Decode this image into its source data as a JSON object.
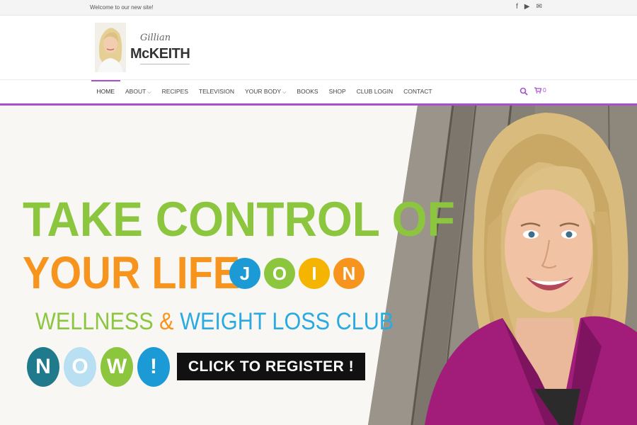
{
  "topbar": {
    "welcome": "Welcome to our new site!",
    "social": [
      {
        "icon": "facebook-icon",
        "glyph": "f"
      },
      {
        "icon": "youtube-icon",
        "glyph": "▶"
      },
      {
        "icon": "mail-icon",
        "glyph": "✉"
      }
    ]
  },
  "logo": {
    "script": "Gillian",
    "name": "McKEITH"
  },
  "nav": {
    "items": [
      {
        "label": "HOME",
        "active": true
      },
      {
        "label": "ABOUT",
        "caret": true
      },
      {
        "label": "RECIPES"
      },
      {
        "label": "TELEVISION"
      },
      {
        "label": "YOUR BODY",
        "caret": true
      },
      {
        "label": "BOOKS"
      },
      {
        "label": "SHOP"
      },
      {
        "label": "CLUB LOGIN"
      },
      {
        "label": "CONTACT"
      }
    ],
    "cart_count": "0",
    "accent": "#a84fd0"
  },
  "hero": {
    "line1": "TAKE CONTROL OF",
    "line2": "YOUR LIFE",
    "join": [
      {
        "letter": "J",
        "color": "#1c9ad6"
      },
      {
        "letter": "O",
        "color": "#8cc63f"
      },
      {
        "letter": "I",
        "color": "#f4b400"
      },
      {
        "letter": "N",
        "color": "#f7941d"
      }
    ],
    "club_a": "WELLNESS",
    "club_amp": "&",
    "club_b": "WEIGHT LOSS CLUB",
    "now": [
      {
        "letter": "N",
        "color": "#1f7a8c"
      },
      {
        "letter": "O",
        "color": "#b8dff2"
      },
      {
        "letter": "W",
        "color": "#8cc63f"
      },
      {
        "letter": "!",
        "color": "#1c9ad6"
      }
    ],
    "register": "CLICK TO REGISTER !",
    "colors": {
      "green": "#8cc63f",
      "orange": "#f7941d",
      "blue": "#29aae1"
    }
  }
}
